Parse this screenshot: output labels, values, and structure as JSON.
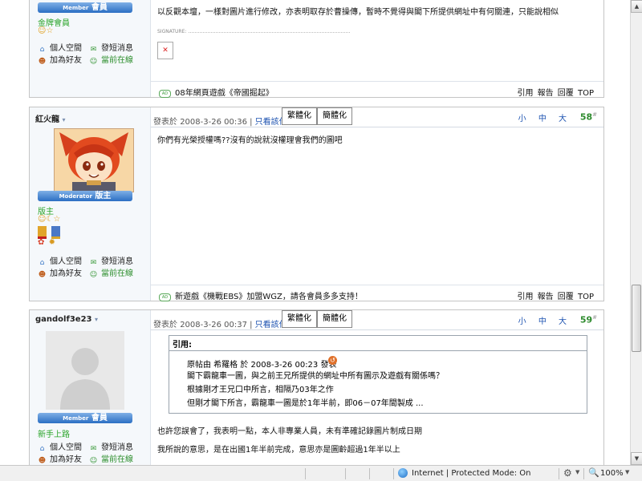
{
  "post1": {
    "rank_label_small": "Member",
    "rank_label": "會員",
    "rank_text": "金牌會員",
    "links": {
      "space": "個人空間",
      "message": "發短消息",
      "add_friend": "加為好友",
      "online": "當前在線"
    },
    "content_line": "以反觀本壇，一樣對圖片進行修改，亦表明取存於曹操傳，暫時不覺得與閣下所提供網址中有何關連，只能說相似",
    "signature_label": "SIGNATURE:",
    "ad_badge": "AD",
    "ad_text": "08年網頁遊戲《帝國掘起》",
    "foot_links": "引用 報告 回覆 TOP"
  },
  "post2": {
    "author": "紅火龍",
    "dropdown": "▾",
    "rank_label_small": "Moderator",
    "rank_label": "版主",
    "rank_text": "版主",
    "posted_prefix": "發表於",
    "posted_time": "2008-3-26 00:36",
    "only_author": "只看該作者",
    "btn_trad": "繁體化",
    "btn_simp": "簡體化",
    "sizes": "小 中 大",
    "floor": "58",
    "floor_sup": "#",
    "content": "你們有光榮授權嗎??沒有的說就沒權理會我們的圖吧",
    "links": {
      "space": "個人空間",
      "message": "發短消息",
      "add_friend": "加為好友",
      "online": "當前在線"
    },
    "ad_badge": "AD",
    "ad_text": "新遊戲《機戰EBS》加盟WGZ，請各會員多多支持！",
    "foot_links": "引用 報告 回覆 TOP"
  },
  "post3": {
    "author": "gandolf3e23",
    "dropdown": "▾",
    "rank_label_small": "Member",
    "rank_label": "會員",
    "rank_text": "新手上路",
    "posted_prefix": "發表於",
    "posted_time": "2008-3-26 00:37",
    "only_author": "只看該作者",
    "btn_trad": "繁體化",
    "btn_simp": "簡體化",
    "sizes": "小 中 大",
    "floor": "59",
    "floor_sup": "#",
    "quote_title": "引用:",
    "quote_lines": [
      "原帖由 希羅格 於 2008-3-26 00:23 發表",
      "閣下霸龍車一圖，與之前王兄所提供的網址中所有圖示及遊戲有關係嗎？",
      "根據剛才王兄口中所言，相隔乃03年之作",
      "但剛才閣下所言，霸龍車一圖是於1年半前，即06－07年間製成 ..."
    ],
    "content_lines": [
      "也許您誤會了，我表明一點，本人非專業人員，未有準確記錄圖片制成日期",
      "我所說的意思，是在出國1年半前完成，意思亦是圖齡超過1年半以上"
    ],
    "links": {
      "space": "個人空間",
      "message": "發短消息",
      "add_friend": "加為好友",
      "online": "當前在線"
    }
  },
  "statusbar": {
    "zone": "Internet | Protected Mode: On",
    "zoom": "100%"
  },
  "colors": {
    "accent": "#1c52b0",
    "floor": "#2e8b2e",
    "rank_bar": "#2b6fc3",
    "online": "#2e8f2e"
  }
}
